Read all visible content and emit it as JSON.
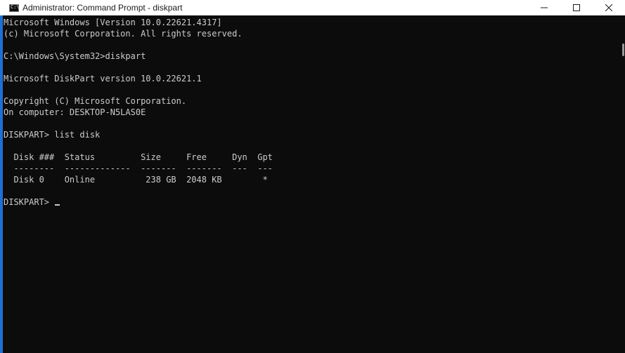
{
  "window": {
    "title": "Administrator: Command Prompt - diskpart",
    "icon": "cmd-icon",
    "controls": [
      "minimize-icon",
      "maximize-icon",
      "close-icon"
    ]
  },
  "console": {
    "lines": [
      "Microsoft Windows [Version 10.0.22621.4317]",
      "(c) Microsoft Corporation. All rights reserved.",
      "",
      "C:\\Windows\\System32>diskpart",
      "",
      "Microsoft DiskPart version 10.0.22621.1",
      "",
      "Copyright (C) Microsoft Corporation.",
      "On computer: DESKTOP-N5LAS0E",
      "",
      "DISKPART> list disk",
      "",
      "  Disk ###  Status         Size     Free     Dyn  Gpt",
      "  --------  -------------  -------  -------  ---  ---",
      "  Disk 0    Online          238 GB  2048 KB        *",
      "",
      "DISKPART> "
    ],
    "table": {
      "headers": [
        "Disk ###",
        "Status",
        "Size",
        "Free",
        "Dyn",
        "Gpt"
      ],
      "rows": [
        [
          "Disk 0",
          "Online",
          "238 GB",
          "2048 KB",
          "",
          "*"
        ]
      ]
    },
    "prompt": "DISKPART> "
  },
  "colors": {
    "background": "#0c0c0c",
    "text": "#cccccc",
    "accent": "#1e6fd6",
    "titlebar": "#ffffff"
  }
}
